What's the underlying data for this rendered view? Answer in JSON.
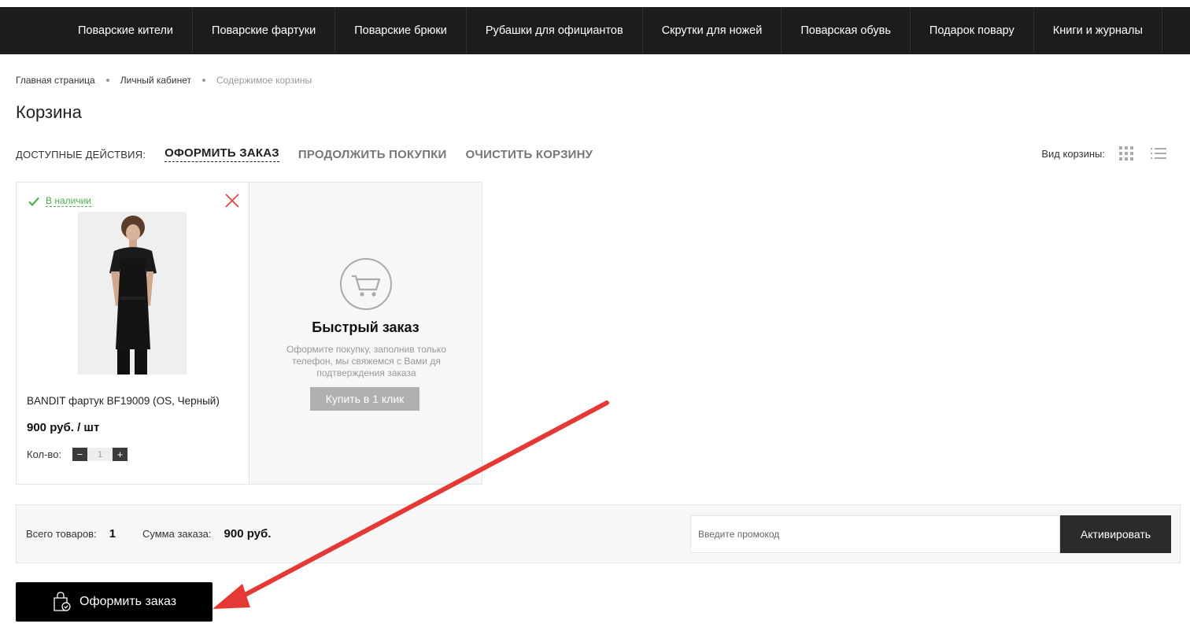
{
  "nav": {
    "items": [
      "Поварские кители",
      "Поварские фартуки",
      "Поварские брюки",
      "Рубашки для официантов",
      "Скрутки для ножей",
      "Поварская обувь",
      "Подарок повару",
      "Книги и журналы"
    ]
  },
  "breadcrumb": {
    "items": [
      "Главная страница",
      "Личный кабинет",
      "Содержимое корзины"
    ]
  },
  "page": {
    "title": "Корзина"
  },
  "actions": {
    "label": "ДОСТУПНЫЕ ДЕЙСТВИЯ:",
    "checkout": "ОФОРМИТЬ ЗАКАЗ",
    "continue": "ПРОДОЛЖИТЬ ПОКУПКИ",
    "clear": "ОЧИСТИТЬ КОРЗИНУ"
  },
  "view": {
    "label": "Вид корзины:"
  },
  "product": {
    "stock": "В наличии",
    "name": "BANDIT фартук BF19009 (OS, Черный)",
    "price": "900 руб. / шт",
    "qty_label": "Кол-во:",
    "qty_value": "1",
    "minus": "−",
    "plus": "+"
  },
  "quick_order": {
    "title": "Быстрый заказ",
    "description": "Оформите покупку, заполнив только телефон, мы свяжемся с Вами дя подтверждения заказа",
    "button": "Купить в 1 клик"
  },
  "summary": {
    "items_label": "Всего товаров:",
    "items_value": "1",
    "sum_label": "Сумма заказа:",
    "sum_value": "900 руб.",
    "promo_placeholder": "Введите промокод",
    "promo_button": "Активировать"
  },
  "checkout_button": "Оформить заказ",
  "colors": {
    "nav_bg": "#1c1c1c",
    "in_stock": "#4caf50",
    "remove": "#e53935",
    "arrow": "#e53935"
  }
}
